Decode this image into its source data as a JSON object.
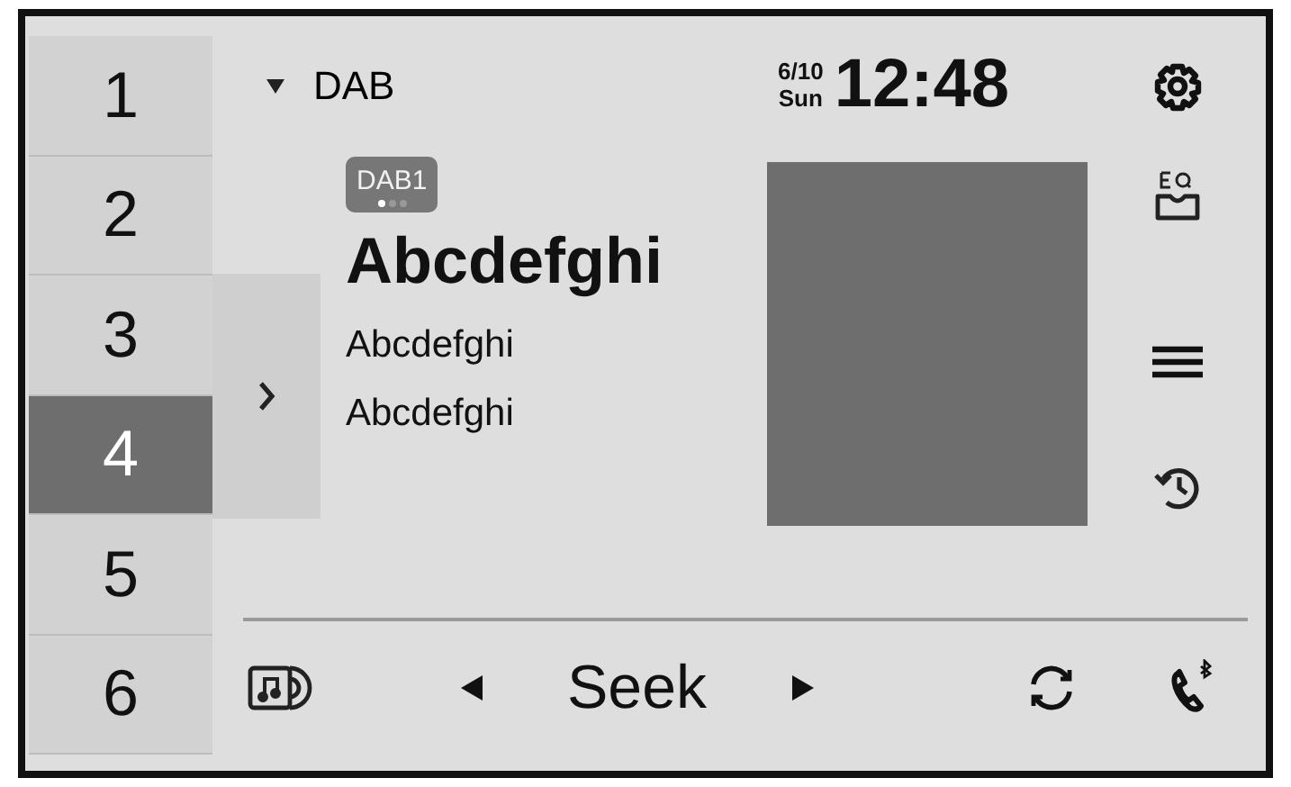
{
  "presets": [
    {
      "label": "1",
      "selected": false
    },
    {
      "label": "2",
      "selected": false
    },
    {
      "label": "3",
      "selected": false
    },
    {
      "label": "4",
      "selected": true
    },
    {
      "label": "5",
      "selected": false
    },
    {
      "label": "6",
      "selected": false
    }
  ],
  "source": {
    "label": "DAB"
  },
  "clock": {
    "date": "6/10",
    "day": "Sun",
    "time": "12:48"
  },
  "band": {
    "label": "DAB1",
    "pages": [
      {
        "selected": true
      },
      {
        "selected": false
      },
      {
        "selected": false
      }
    ]
  },
  "station": {
    "title": "Abcdefghi",
    "lines": [
      "Abcdefghi",
      "Abcdefghi"
    ]
  },
  "seek": {
    "label": "Seek"
  }
}
